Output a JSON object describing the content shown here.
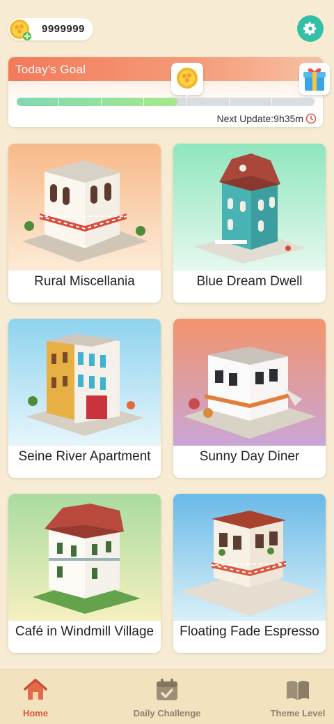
{
  "header": {
    "coins": "9999999",
    "coin_icon": "coin-plus-icon",
    "settings_icon": "gear-icon"
  },
  "goal": {
    "title": "Today's Goal",
    "progress": 0.54,
    "milestone_icon": "coin-reward-icon",
    "final_reward_icon": "gift-icon",
    "next_update": "Next Update:9h35m",
    "clock_icon": "clock-icon"
  },
  "themes": [
    {
      "label": "Rural Miscellania",
      "bg_top": "#f7b989",
      "bg_bottom": "#fdebd7"
    },
    {
      "label": "Blue Dream Dwell",
      "bg_top": "#8fe6bd",
      "bg_bottom": "#e6f8ef"
    },
    {
      "label": "Seine River Apartment",
      "bg_top": "#8ed3ee",
      "bg_bottom": "#e7f5fb"
    },
    {
      "label": "Sunny Day Diner",
      "bg_top": "#f2946c",
      "bg_bottom": "#c9a6d6"
    },
    {
      "label": "Café in Windmill Village",
      "bg_top": "#a9dba0",
      "bg_bottom": "#f6f0bf"
    },
    {
      "label": "Floating Fade Espresso",
      "bg_top": "#6ab9e8",
      "bg_bottom": "#d9f0f7"
    }
  ],
  "nav": [
    {
      "label": "Home",
      "icon": "home-icon",
      "active": true
    },
    {
      "label": "Daily Challenge",
      "icon": "calendar-check-icon",
      "active": false
    },
    {
      "label": "Theme Level",
      "icon": "book-icon",
      "active": false
    }
  ],
  "colors": {
    "accent": "#34bfa7",
    "active_nav": "#d9583f",
    "background": "#f7ecd3"
  }
}
